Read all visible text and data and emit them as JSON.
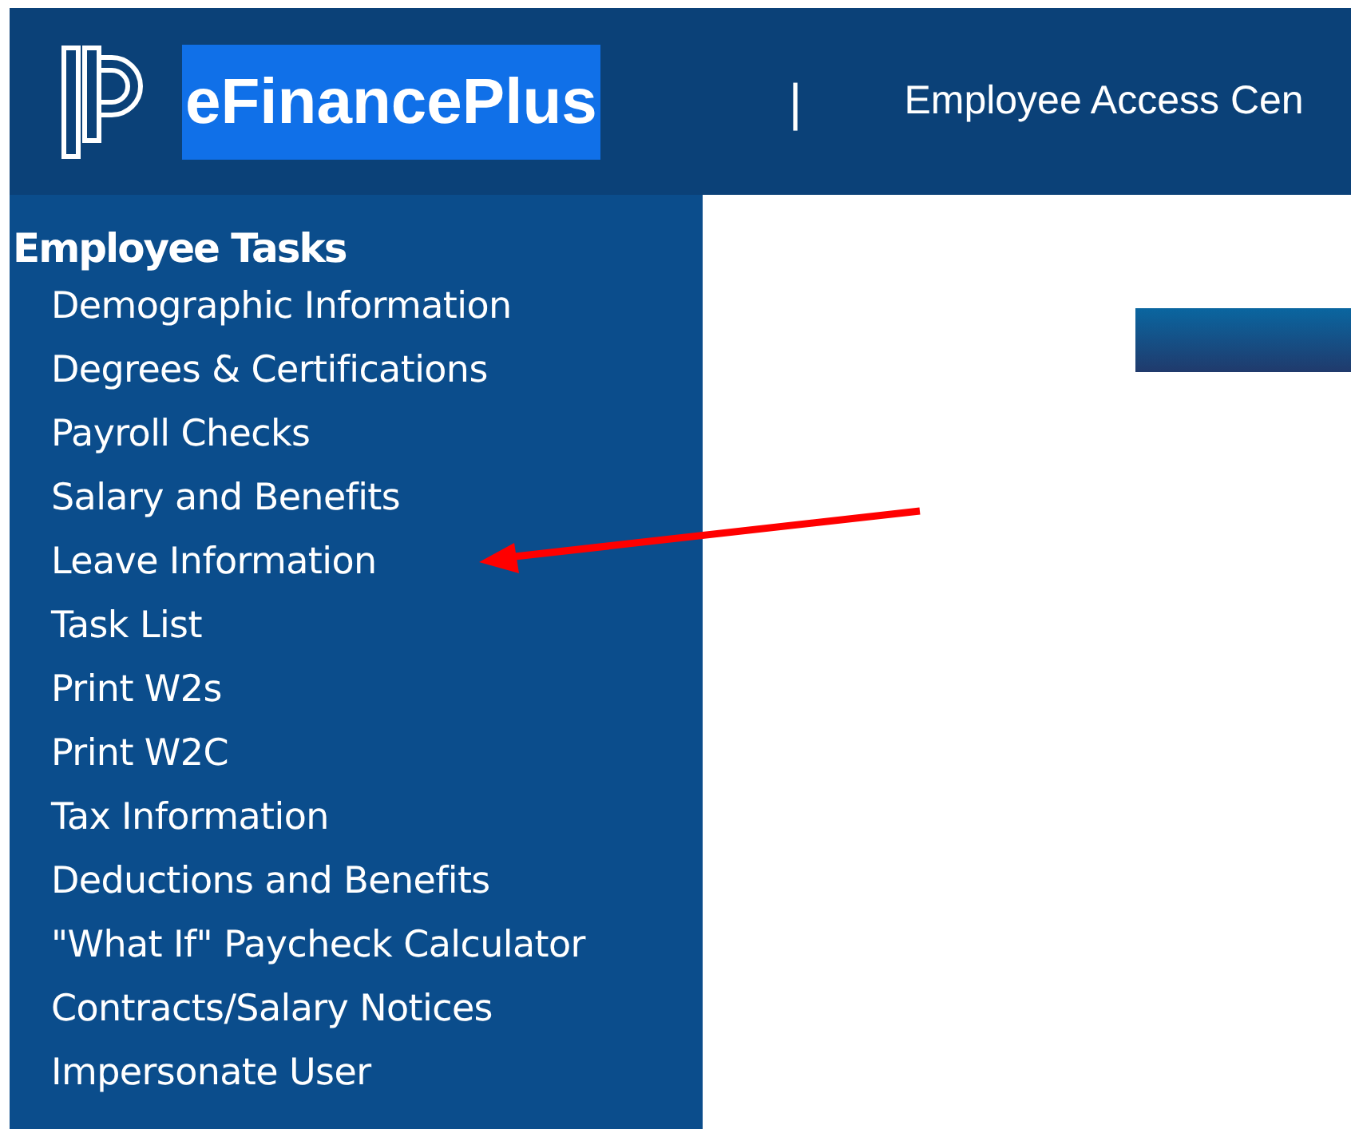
{
  "header": {
    "brand": "eFinancePlus",
    "separator": "|",
    "title": "Employee Access Cen"
  },
  "sidebar": {
    "heading": "Employee Tasks",
    "items": [
      {
        "label": "Demographic Information"
      },
      {
        "label": "Degrees & Certifications"
      },
      {
        "label": "Payroll Checks"
      },
      {
        "label": "Salary and Benefits"
      },
      {
        "label": "Leave Information"
      },
      {
        "label": "Task List"
      },
      {
        "label": "Print W2s"
      },
      {
        "label": "Print W2C"
      },
      {
        "label": "Tax Information"
      },
      {
        "label": "Deductions and Benefits"
      },
      {
        "label": "\"What If\" Paycheck Calculator"
      },
      {
        "label": "Contracts/Salary Notices"
      },
      {
        "label": "Impersonate User"
      }
    ]
  }
}
